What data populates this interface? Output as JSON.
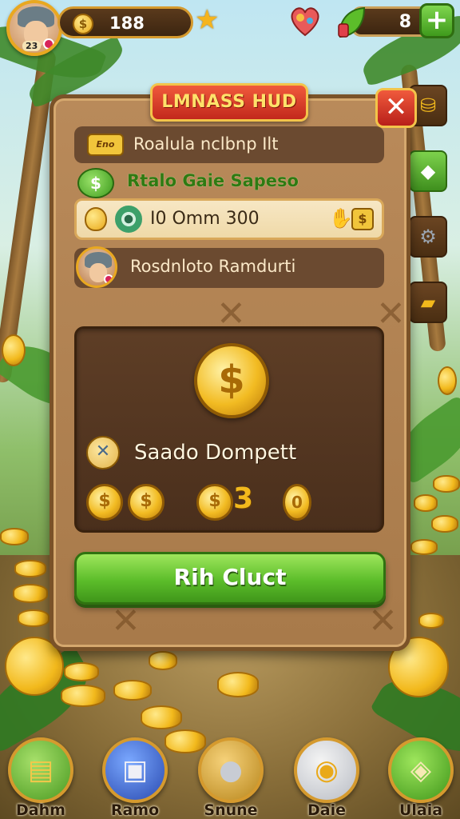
{
  "topbar": {
    "player_level": "23",
    "coins": "188",
    "gems": "8",
    "add_label": "+",
    "coin_symbol": "$"
  },
  "panel": {
    "title": "LMNASS HUD",
    "close_label": "✕",
    "row1": {
      "badge": "Eno",
      "text": "Roalula nclbnp Ilt"
    },
    "row2": {
      "text": "Rtalo Gaie Sapeso"
    },
    "row3": {
      "text": "I0 Omm 300"
    },
    "row4": {
      "text": "Rosdnloto Ramdurti"
    },
    "reward": {
      "coin_symbol": "$",
      "title": "Saado Dompett",
      "amount": "3",
      "zero": "0",
      "x_symbol": "✕"
    },
    "claim_button": "Rih Cluct"
  },
  "bottom_nav": [
    {
      "label": "Dahm",
      "icon": "cash-stack-icon"
    },
    {
      "label": "Ramo",
      "icon": "gift-box-icon"
    },
    {
      "label": "Snune",
      "icon": "magnifier-icon"
    },
    {
      "label": "Daie",
      "icon": "gold-coin-icon"
    },
    {
      "label": "Ulaia",
      "icon": "green-gem-icon"
    }
  ],
  "colors": {
    "accent_gold": "#f2b91c",
    "button_green": "#5cbd2a",
    "close_red": "#c2281c",
    "panel_brown": "#a87a4a"
  }
}
